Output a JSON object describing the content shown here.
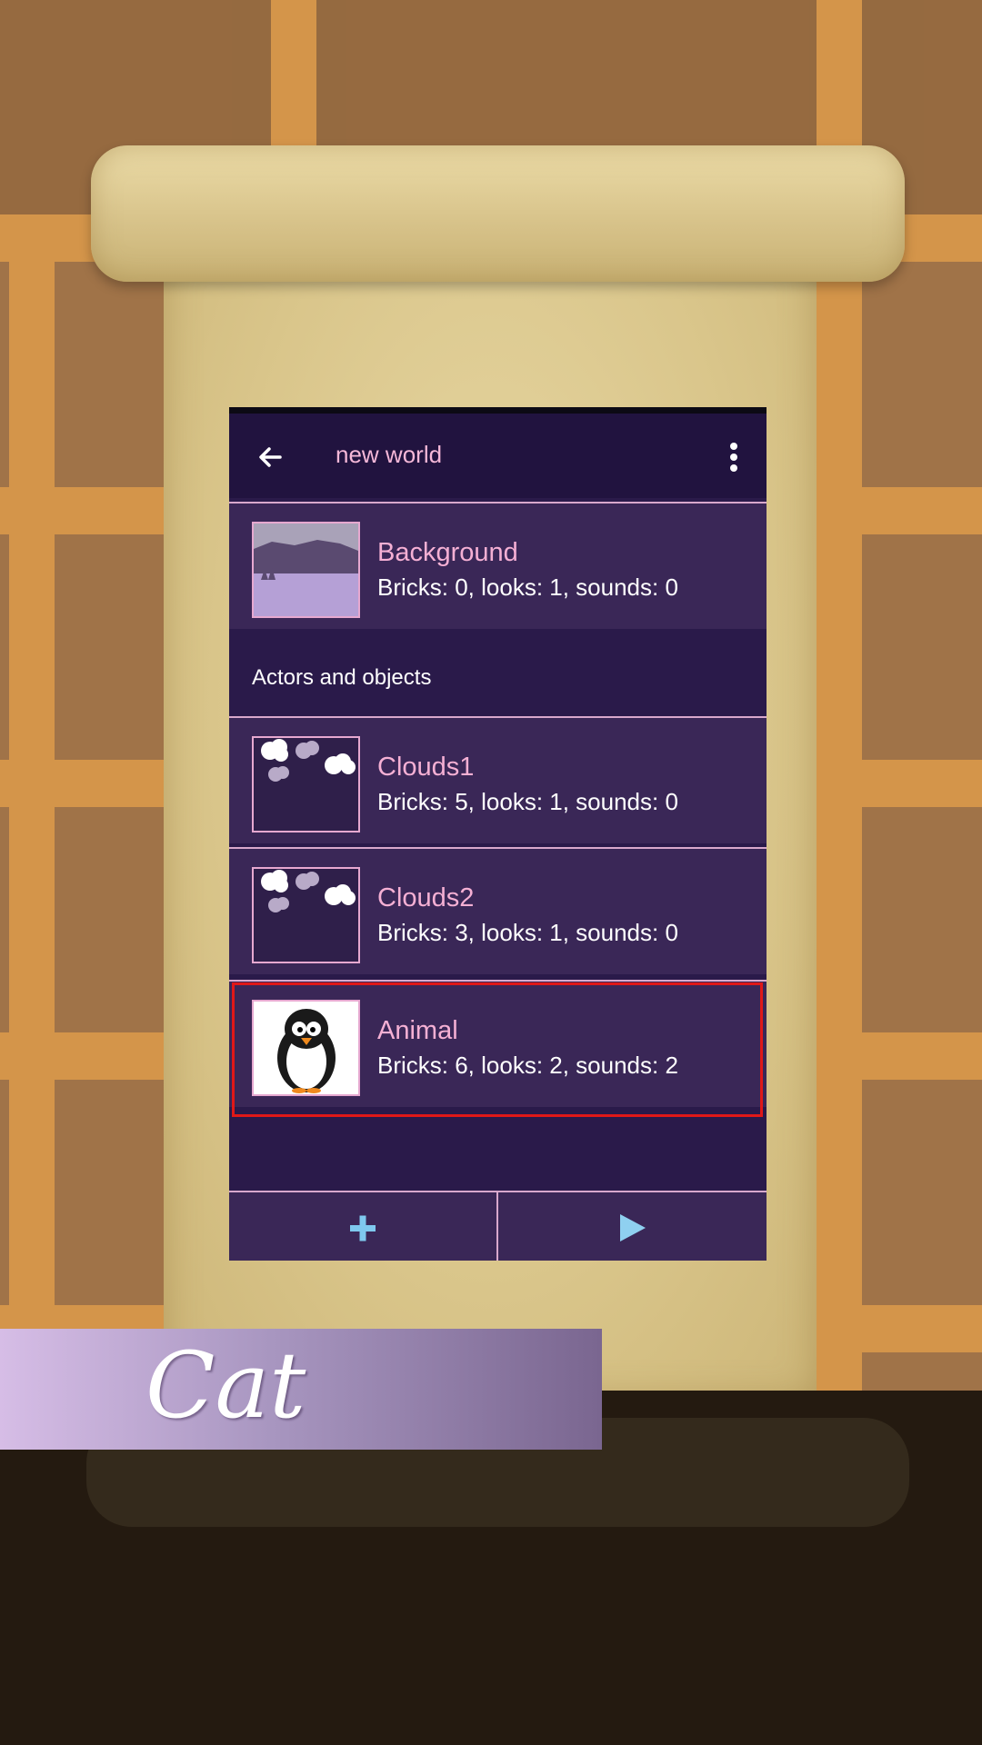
{
  "app": {
    "title": "new world"
  },
  "background_item": {
    "name": "Background",
    "info": "Bricks: 0, looks: 1, sounds: 0"
  },
  "section": {
    "label": "Actors and objects"
  },
  "objects": [
    {
      "name": "Clouds1",
      "info": "Bricks: 5, looks: 1, sounds: 0"
    },
    {
      "name": "Clouds2",
      "info": "Bricks: 3, looks: 1, sounds: 0"
    },
    {
      "name": "Animal",
      "info": "Bricks: 6, looks: 2, sounds: 2"
    }
  ],
  "banner": {
    "text": "Cat"
  },
  "icons": {
    "back": "arrow-left-icon",
    "menu": "more-vert-icon",
    "add": "plus-icon",
    "play": "play-icon"
  },
  "colors": {
    "toolbar": "#21133f",
    "row": "#3a2757",
    "accent_text": "#f5b0d4",
    "add_icon": "#7fc8ee",
    "play_icon": "#8fd0f0",
    "highlight": "#e01818"
  }
}
